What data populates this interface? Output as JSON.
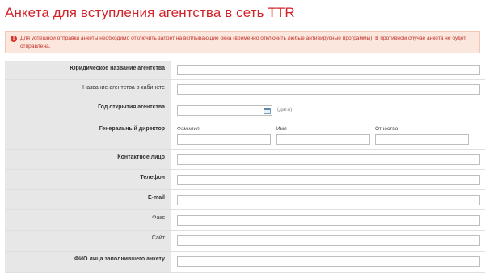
{
  "page": {
    "title": "Анкета для вступления агентства в сеть TTR"
  },
  "alert": {
    "icon": "exclamation-icon",
    "text": "Для успешной отправки анкеты необходимо отключить запрет на всплывающие окна (временно отключить любые антивирусные программы). В противном случае анкета не будет отправлена."
  },
  "form": {
    "legal_name_label": "Юридическое название агентства",
    "cabinet_name_label": "Название агентства в кабинете",
    "opening_year_label": "Год открытия агентства",
    "date_hint": "(дата)",
    "director_label": "Генеральный директор",
    "surname_label": "Фамилия",
    "name_label": "Имя",
    "patronymic_label": "Отчество",
    "contact_label": "Контактное лицо",
    "phone_label": "Телефон",
    "email_label": "E-mail",
    "fax_label": "Факс",
    "site_label": "Сайт",
    "filled_by_label": "ФИО лица заполнившего анкету"
  },
  "colors": {
    "title": "#d1232a",
    "alert_bg": "#fbe7dd",
    "alert_text": "#c2322b",
    "label_bg": "#e7e7e7"
  }
}
